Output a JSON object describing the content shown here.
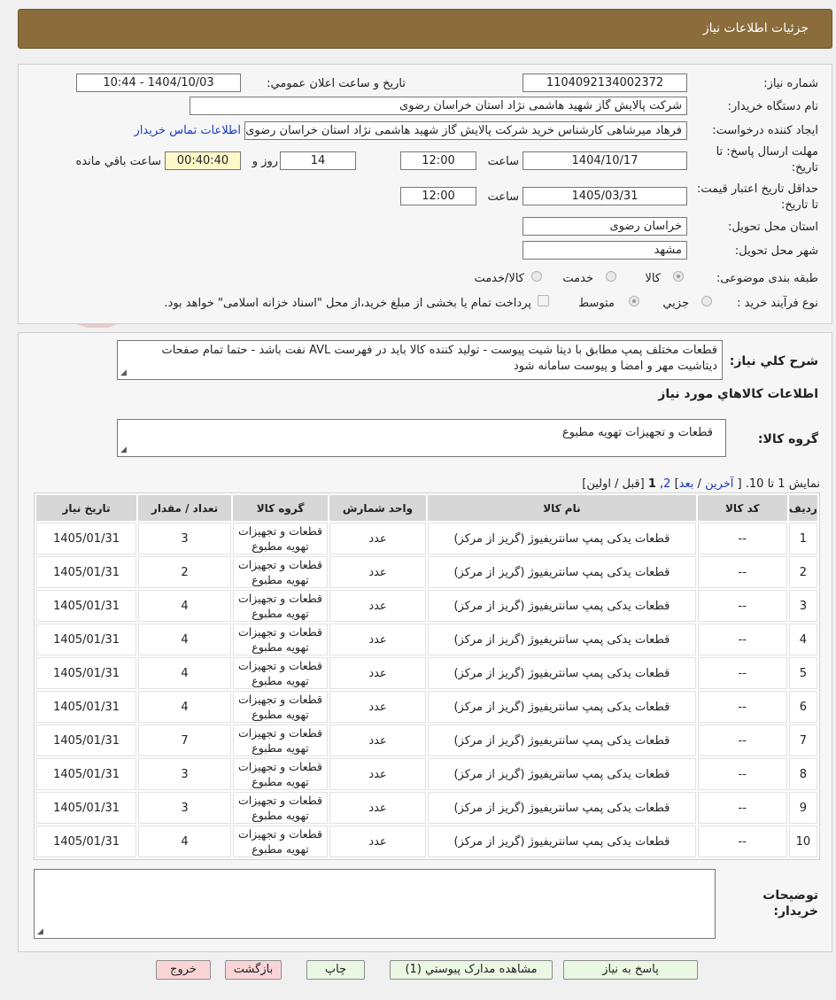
{
  "header": {
    "title": "جزئیات اطلاعات نیاز"
  },
  "watermark": {
    "text": "AriaTender.neT"
  },
  "form": {
    "need_number_label": "شماره نیاز:",
    "need_number": "1104092134002372",
    "announce_label": "تاریخ و ساعت اعلان عمومي:",
    "announce_value": "1404/10/03 - 10:44",
    "buyer_label": "نام دستگاه خريدار:",
    "buyer_value": "شرکت پالایش گاز شهید هاشمی نژاد   استان خراسان رضوی",
    "requester_label": "ايجاد کننده درخواست:",
    "requester_value": "فرهاد میرشاهی کارشناس خرید شرکت پالایش گاز شهید هاشمی نژاد   استان خراسان رضوی",
    "contact_link": "اطلاعات تماس خريدار",
    "deadline_label": "مهلت ارسال پاسخ: تا تاریخ:",
    "deadline_date": "1404/10/17",
    "time_label": "ساعت",
    "deadline_time": "12:00",
    "days_value": "14",
    "days_label": "روز و",
    "remaining_time": "00:40:40",
    "remaining_label": "ساعت باقي مانده",
    "validity_label": "حداقل تاريخ اعتبار قیمت: تا تاریخ:",
    "validity_date": "1405/03/31",
    "validity_time": "12:00",
    "province_label": "استان محل تحويل:",
    "province_value": "خراسان رضوی",
    "city_label": "شهر محل تحويل:",
    "city_value": "مشهد",
    "category_label": "طبقه بندی موضوعی:",
    "category_options": [
      "کالا",
      "خدمت",
      "کالا/خدمت"
    ],
    "process_label": "نوع فرآیند خرید :",
    "process_options": [
      "جزیي",
      "متوسط"
    ],
    "payment_note": "پرداخت تمام یا بخشی از مبلغ خرید،از محل \"اسناد خزانه اسلامی\" خواهد بود."
  },
  "summary": {
    "label": "شرح کلي نياز:",
    "text": "قطعات مختلف پمپ مطابق با دیتا شیت پیوست - تولید کننده کالا باید در فهرست AVL نفت باشد - حتما تمام صفحات دیتاشیت مهر و امضا و پیوست سامانه شود",
    "goods_info_title": "اطلاعات کالاهاي مورد نياز",
    "group_label": "گروه کالا:",
    "group_value": "قطعات و تجهیزات تهویه مطبوع"
  },
  "pager": {
    "showing": "نمایش 1 تا 10.",
    "open": "[",
    "last": "آخرین",
    "sep1": "/",
    "next": "بعد",
    "close1": "]",
    "page2": "2",
    "comma": ",",
    "page1": "1",
    "prev_first": "[قبل / اولین]"
  },
  "table": {
    "headers": [
      "رديف",
      "کد کالا",
      "نام کالا",
      "واحد شمارش",
      "گروه کالا",
      "تعداد / مقدار",
      "تاریخ نیاز"
    ],
    "rows": [
      {
        "n": "1",
        "code": "--",
        "name": "قطعات یدکی پمپ سانتریفیوژ (گریز از مرکز)",
        "unit": "عدد",
        "group": "قطعات و تجهیزات تهویه مطبوع",
        "qty": "3",
        "date": "1405/01/31"
      },
      {
        "n": "2",
        "code": "--",
        "name": "قطعات یدکی پمپ سانتریفیوژ (گریز از مرکز)",
        "unit": "عدد",
        "group": "قطعات و تجهیزات تهویه مطبوع",
        "qty": "2",
        "date": "1405/01/31"
      },
      {
        "n": "3",
        "code": "--",
        "name": "قطعات یدکی پمپ سانتریفیوژ (گریز از مرکز)",
        "unit": "عدد",
        "group": "قطعات و تجهیزات تهویه مطبوع",
        "qty": "4",
        "date": "1405/01/31"
      },
      {
        "n": "4",
        "code": "--",
        "name": "قطعات یدکی پمپ سانتریفیوژ (گریز از مرکز)",
        "unit": "عدد",
        "group": "قطعات و تجهیزات تهویه مطبوع",
        "qty": "4",
        "date": "1405/01/31"
      },
      {
        "n": "5",
        "code": "--",
        "name": "قطعات یدکی پمپ سانتریفیوژ (گریز از مرکز)",
        "unit": "عدد",
        "group": "قطعات و تجهیزات تهویه مطبوع",
        "qty": "4",
        "date": "1405/01/31"
      },
      {
        "n": "6",
        "code": "--",
        "name": "قطعات یدکی پمپ سانتریفیوژ (گریز از مرکز)",
        "unit": "عدد",
        "group": "قطعات و تجهیزات تهویه مطبوع",
        "qty": "4",
        "date": "1405/01/31"
      },
      {
        "n": "7",
        "code": "--",
        "name": "قطعات یدکی پمپ سانتریفیوژ (گریز از مرکز)",
        "unit": "عدد",
        "group": "قطعات و تجهیزات تهویه مطبوع",
        "qty": "7",
        "date": "1405/01/31"
      },
      {
        "n": "8",
        "code": "--",
        "name": "قطعات یدکی پمپ سانتریفیوژ (گریز از مرکز)",
        "unit": "عدد",
        "group": "قطعات و تجهیزات تهویه مطبوع",
        "qty": "3",
        "date": "1405/01/31"
      },
      {
        "n": "9",
        "code": "--",
        "name": "قطعات یدکی پمپ سانتریفیوژ (گریز از مرکز)",
        "unit": "عدد",
        "group": "قطعات و تجهیزات تهویه مطبوع",
        "qty": "3",
        "date": "1405/01/31"
      },
      {
        "n": "10",
        "code": "--",
        "name": "قطعات یدکی پمپ سانتریفیوژ (گریز از مرکز)",
        "unit": "عدد",
        "group": "قطعات و تجهیزات تهویه مطبوع",
        "qty": "4",
        "date": "1405/01/31"
      }
    ]
  },
  "notes": {
    "label": "توضیحات خریدار:",
    "value": ""
  },
  "buttons": {
    "reply": "پاسخ به نياز",
    "attachments": "مشاهده مدارک پيوستي (1)",
    "print": "چاپ",
    "back": "بازگشت",
    "exit": "خروج"
  },
  "colors": {
    "header_bg": "#8a6d3b",
    "timer_bg": "#fff9c9",
    "link": "#1a39c4",
    "accent_green": "#eaf7e3",
    "accent_pink": "#f9d4d6"
  }
}
